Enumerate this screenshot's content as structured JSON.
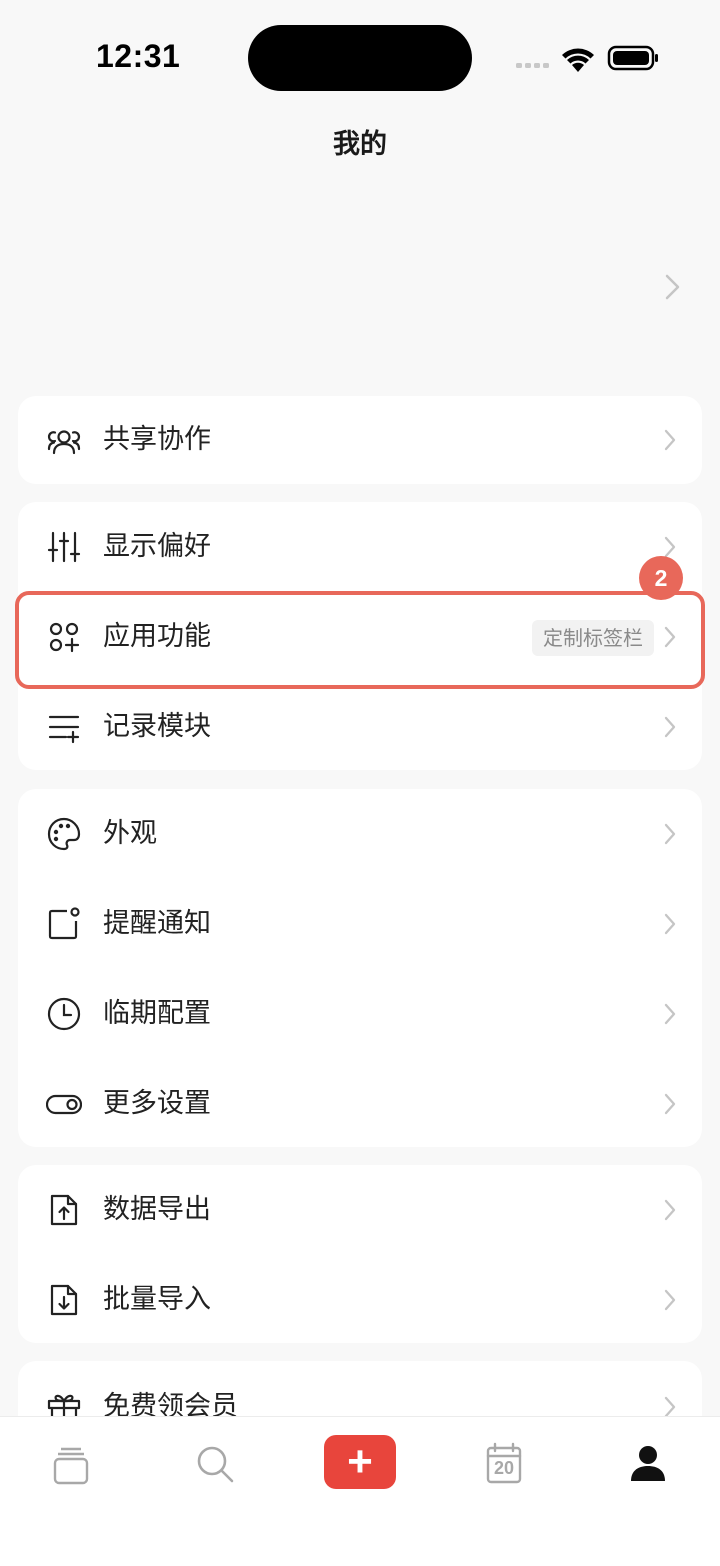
{
  "status_bar": {
    "time": "12:31"
  },
  "header": {
    "title": "我的"
  },
  "sections": {
    "share": [
      {
        "label": "共享协作",
        "icon": "people-icon"
      }
    ],
    "prefs": [
      {
        "label": "显示偏好",
        "icon": "sliders-icon"
      },
      {
        "label": "应用功能",
        "icon": "apps-grid-icon",
        "tag": "定制标签栏"
      },
      {
        "label": "记录模块",
        "icon": "list-add-icon"
      }
    ],
    "settings": [
      {
        "label": "外观",
        "icon": "palette-icon"
      },
      {
        "label": "提醒通知",
        "icon": "notification-icon"
      },
      {
        "label": "临期配置",
        "icon": "clock-icon"
      },
      {
        "label": "更多设置",
        "icon": "toggle-icon"
      }
    ],
    "data": [
      {
        "label": "数据导出",
        "icon": "file-export-icon"
      },
      {
        "label": "批量导入",
        "icon": "file-import-icon"
      }
    ],
    "member": [
      {
        "label": "免费领会员",
        "icon": "gift-icon"
      }
    ]
  },
  "highlight": {
    "badge": "2"
  },
  "tabbar": {
    "items": [
      "stack-icon",
      "search-icon",
      "add-icon",
      "calendar-icon",
      "profile-icon"
    ],
    "add_symbol": "+",
    "calendar_day": "20",
    "active": "profile-icon"
  },
  "colors": {
    "accent": "#e8453c",
    "highlight": "#e8685a",
    "background": "#f8f8f8",
    "card": "#ffffff"
  }
}
